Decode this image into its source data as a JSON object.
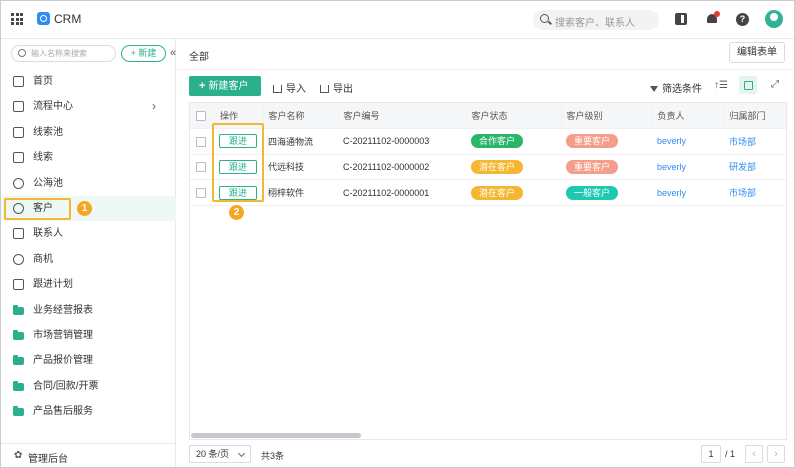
{
  "header": {
    "app_name": "CRM",
    "search_placeholder": "搜索客户、联系人",
    "icons": [
      "apps-grid-icon",
      "crm-logo-icon",
      "search-icon",
      "panel-icon",
      "notification-bell-icon",
      "help-icon",
      "user-avatar-icon"
    ],
    "colors": {
      "accent": "#2bb08e",
      "link": "#2e8ff0",
      "notification": "#e53935"
    }
  },
  "sidebar": {
    "search_placeholder": "输入名称来搜索",
    "new_label": "+ 新建",
    "collapse_icon": "«",
    "items": [
      {
        "label": "首页",
        "icon": "home-icon"
      },
      {
        "label": "流程中心",
        "icon": "flow-icon",
        "has_submenu": true
      },
      {
        "label": "线索池",
        "icon": "lead-pool-icon"
      },
      {
        "label": "线索",
        "icon": "lead-icon"
      },
      {
        "label": "公海池",
        "icon": "public-pool-icon"
      },
      {
        "label": "客户",
        "icon": "customer-icon",
        "active": true
      },
      {
        "label": "联系人",
        "icon": "contact-icon"
      },
      {
        "label": "商机",
        "icon": "opportunity-icon"
      },
      {
        "label": "跟进计划",
        "icon": "follow-plan-icon"
      },
      {
        "label": "业务经营报表",
        "icon": "folder-icon"
      },
      {
        "label": "市场营销管理",
        "icon": "folder-icon"
      },
      {
        "label": "产品报价管理",
        "icon": "folder-icon"
      },
      {
        "label": "合同/回款/开票",
        "icon": "folder-icon"
      },
      {
        "label": "产品售后服务",
        "icon": "folder-icon"
      }
    ],
    "chevron": "›",
    "footer_label": "管理后台",
    "footer_icon": "✿"
  },
  "main": {
    "title": "全部",
    "edit_form_label": "编辑表单",
    "toolbar": {
      "new_customer_label": "新建客户",
      "import_label": "导入",
      "export_label": "导出",
      "filter_label": "筛选条件",
      "sort_icon": "↑☰",
      "expand_icon": "⤢"
    },
    "table": {
      "headers": [
        "操作",
        "客户名称",
        "客户编号",
        "客户状态",
        "客户级别",
        "负责人",
        "归属部门"
      ],
      "rows": [
        {
          "action": "跟进",
          "name": "四海通物流",
          "code": "C-20211102-0000003",
          "status": "合作客户",
          "status_color": "#2bb56a",
          "level": "重要客户",
          "level_color": "#f59d8b",
          "owner": "beverly",
          "dept": "市场部"
        },
        {
          "action": "跟进",
          "name": "代远科技",
          "code": "C-20211102-0000002",
          "status": "潜在客户",
          "status_color": "#f5b731",
          "level": "重要客户",
          "level_color": "#f59d8b",
          "owner": "beverly",
          "dept": "研发部"
        },
        {
          "action": "跟进",
          "name": "栩梓软件",
          "code": "C-20211102-0000001",
          "status": "潜在客户",
          "status_color": "#f5b731",
          "level": "一般客户",
          "level_color": "#1ec9b0",
          "owner": "beverly",
          "dept": "市场部"
        }
      ]
    },
    "footer": {
      "page_size": "20 条/页",
      "total": "共3条",
      "current_page": "1",
      "page_total": "/ 1",
      "prev": "‹",
      "next": "›"
    }
  },
  "annotations": {
    "step1": "1",
    "step2": "2",
    "highlight_color": "#f5b731"
  }
}
